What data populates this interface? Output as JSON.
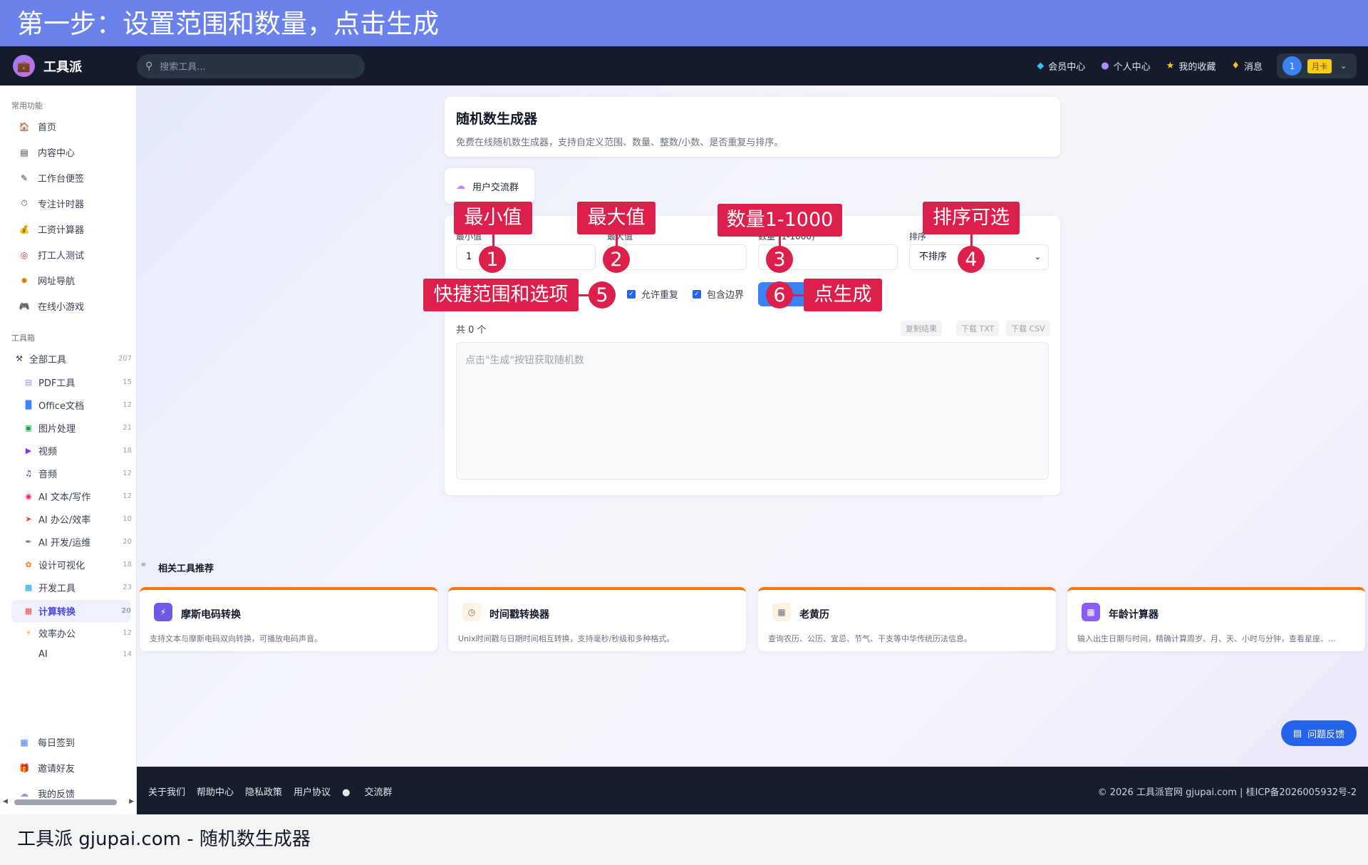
{
  "banner_top": "第一步：设置范围和数量，点击生成",
  "banner_bottom": "工具派 gjupai.com - 随机数生成器",
  "topnav": {
    "logo_text": "工具派",
    "search_placeholder": "搜索工具...",
    "links": [
      {
        "label": "会员中心",
        "icon": "diamond-icon"
      },
      {
        "label": "个人中心",
        "icon": "user-icon"
      },
      {
        "label": "我的收藏",
        "icon": "star-icon"
      },
      {
        "label": "消息",
        "icon": "bell-icon"
      }
    ],
    "user_avatar": "1",
    "user_badge": "月卡"
  },
  "sidebar": {
    "common_title": "常用功能",
    "common": [
      {
        "label": "首页",
        "icon": "home-icon"
      },
      {
        "label": "内容中心",
        "icon": "newspaper-icon"
      },
      {
        "label": "工作台便签",
        "icon": "memo-icon"
      },
      {
        "label": "专注计时器",
        "icon": "stopwatch-icon"
      },
      {
        "label": "工资计算器",
        "icon": "money-bag-icon"
      },
      {
        "label": "打工人测试",
        "icon": "target-icon"
      },
      {
        "label": "网址导航",
        "icon": "compass-icon"
      },
      {
        "label": "在线小游戏",
        "icon": "gamepad-icon"
      }
    ],
    "tools_title": "工具箱",
    "all_tools": {
      "label": "全部工具",
      "count": "207"
    },
    "tools": [
      {
        "label": "PDF工具",
        "count": "15"
      },
      {
        "label": "Office文档",
        "count": "12"
      },
      {
        "label": "图片处理",
        "count": "21"
      },
      {
        "label": "视频",
        "count": "18"
      },
      {
        "label": "音频",
        "count": "12"
      },
      {
        "label": "AI 文本/写作",
        "count": "12"
      },
      {
        "label": "AI 办公/效率",
        "count": "10"
      },
      {
        "label": "AI 开发/运维",
        "count": "20"
      },
      {
        "label": "设计可视化",
        "count": "18"
      },
      {
        "label": "开发工具",
        "count": "23"
      },
      {
        "label": "计算转换",
        "count": "20"
      },
      {
        "label": "效率办公",
        "count": "12"
      },
      {
        "label": "AI",
        "count": "14"
      }
    ],
    "bottom": [
      {
        "label": "每日签到",
        "icon": "calendar-icon"
      },
      {
        "label": "邀请好友",
        "icon": "gift-icon"
      },
      {
        "label": "我的反馈",
        "icon": "speech-bubble-icon"
      }
    ]
  },
  "header": {
    "title": "随机数生成器",
    "desc": "免费在线随机数生成器，支持自定义范围、数量、整数/小数、是否重复与排序。"
  },
  "community": {
    "label": "用户交流群"
  },
  "form": {
    "min_label": "最小值",
    "min_value": "1",
    "max_label": "最大值",
    "max_value": ")",
    "count_label": "数量 (1-1000)",
    "sort_label": "排序",
    "sort_value": "不排序",
    "allow_repeat": "允许重复",
    "include_bounds": "包含边界",
    "result_count": "共 0 个",
    "copy_btn": "复制结果",
    "txt_btn": "下载 TXT",
    "csv_btn": "下载 CSV",
    "output_placeholder": "点击\"生成\"按钮获取随机数"
  },
  "callouts": {
    "c1": "最小值",
    "m1": "1",
    "c2": "最大值",
    "m2": "2",
    "c3": "数量1-1000",
    "m3": "3",
    "c4": "排序可选",
    "m4": "4",
    "c5": "快捷范围和选项",
    "m5": "5",
    "c6": "点生成",
    "m6": "6"
  },
  "related": {
    "title": "相关工具推荐",
    "items": [
      {
        "title": "摩斯电码转换",
        "desc": "支持文本与摩斯电码双向转换，可播放电码声音。",
        "icon": "lightning-icon"
      },
      {
        "title": "时间戳转换器",
        "desc": "Unix时间戳与日期时间相互转换，支持毫秒/秒级和多种格式。",
        "icon": "clock-icon"
      },
      {
        "title": "老黄历",
        "desc": "查询农历、公历、宜忌、节气、干支等中华传统历法信息。",
        "icon": "almanac-icon"
      },
      {
        "title": "年龄计算器",
        "desc": "输入出生日期与时间，精确计算周岁、月、天、小时与分钟，查看星座、...",
        "icon": "calendar-icon"
      }
    ]
  },
  "feedback": "问题反馈",
  "footer": {
    "links": [
      "关于我们",
      "帮助中心",
      "隐私政策",
      "用户协议",
      "交流群"
    ],
    "copyright": "© 2026 工具派官网 gjupai.com | 桂ICP备2026005932号-2"
  }
}
